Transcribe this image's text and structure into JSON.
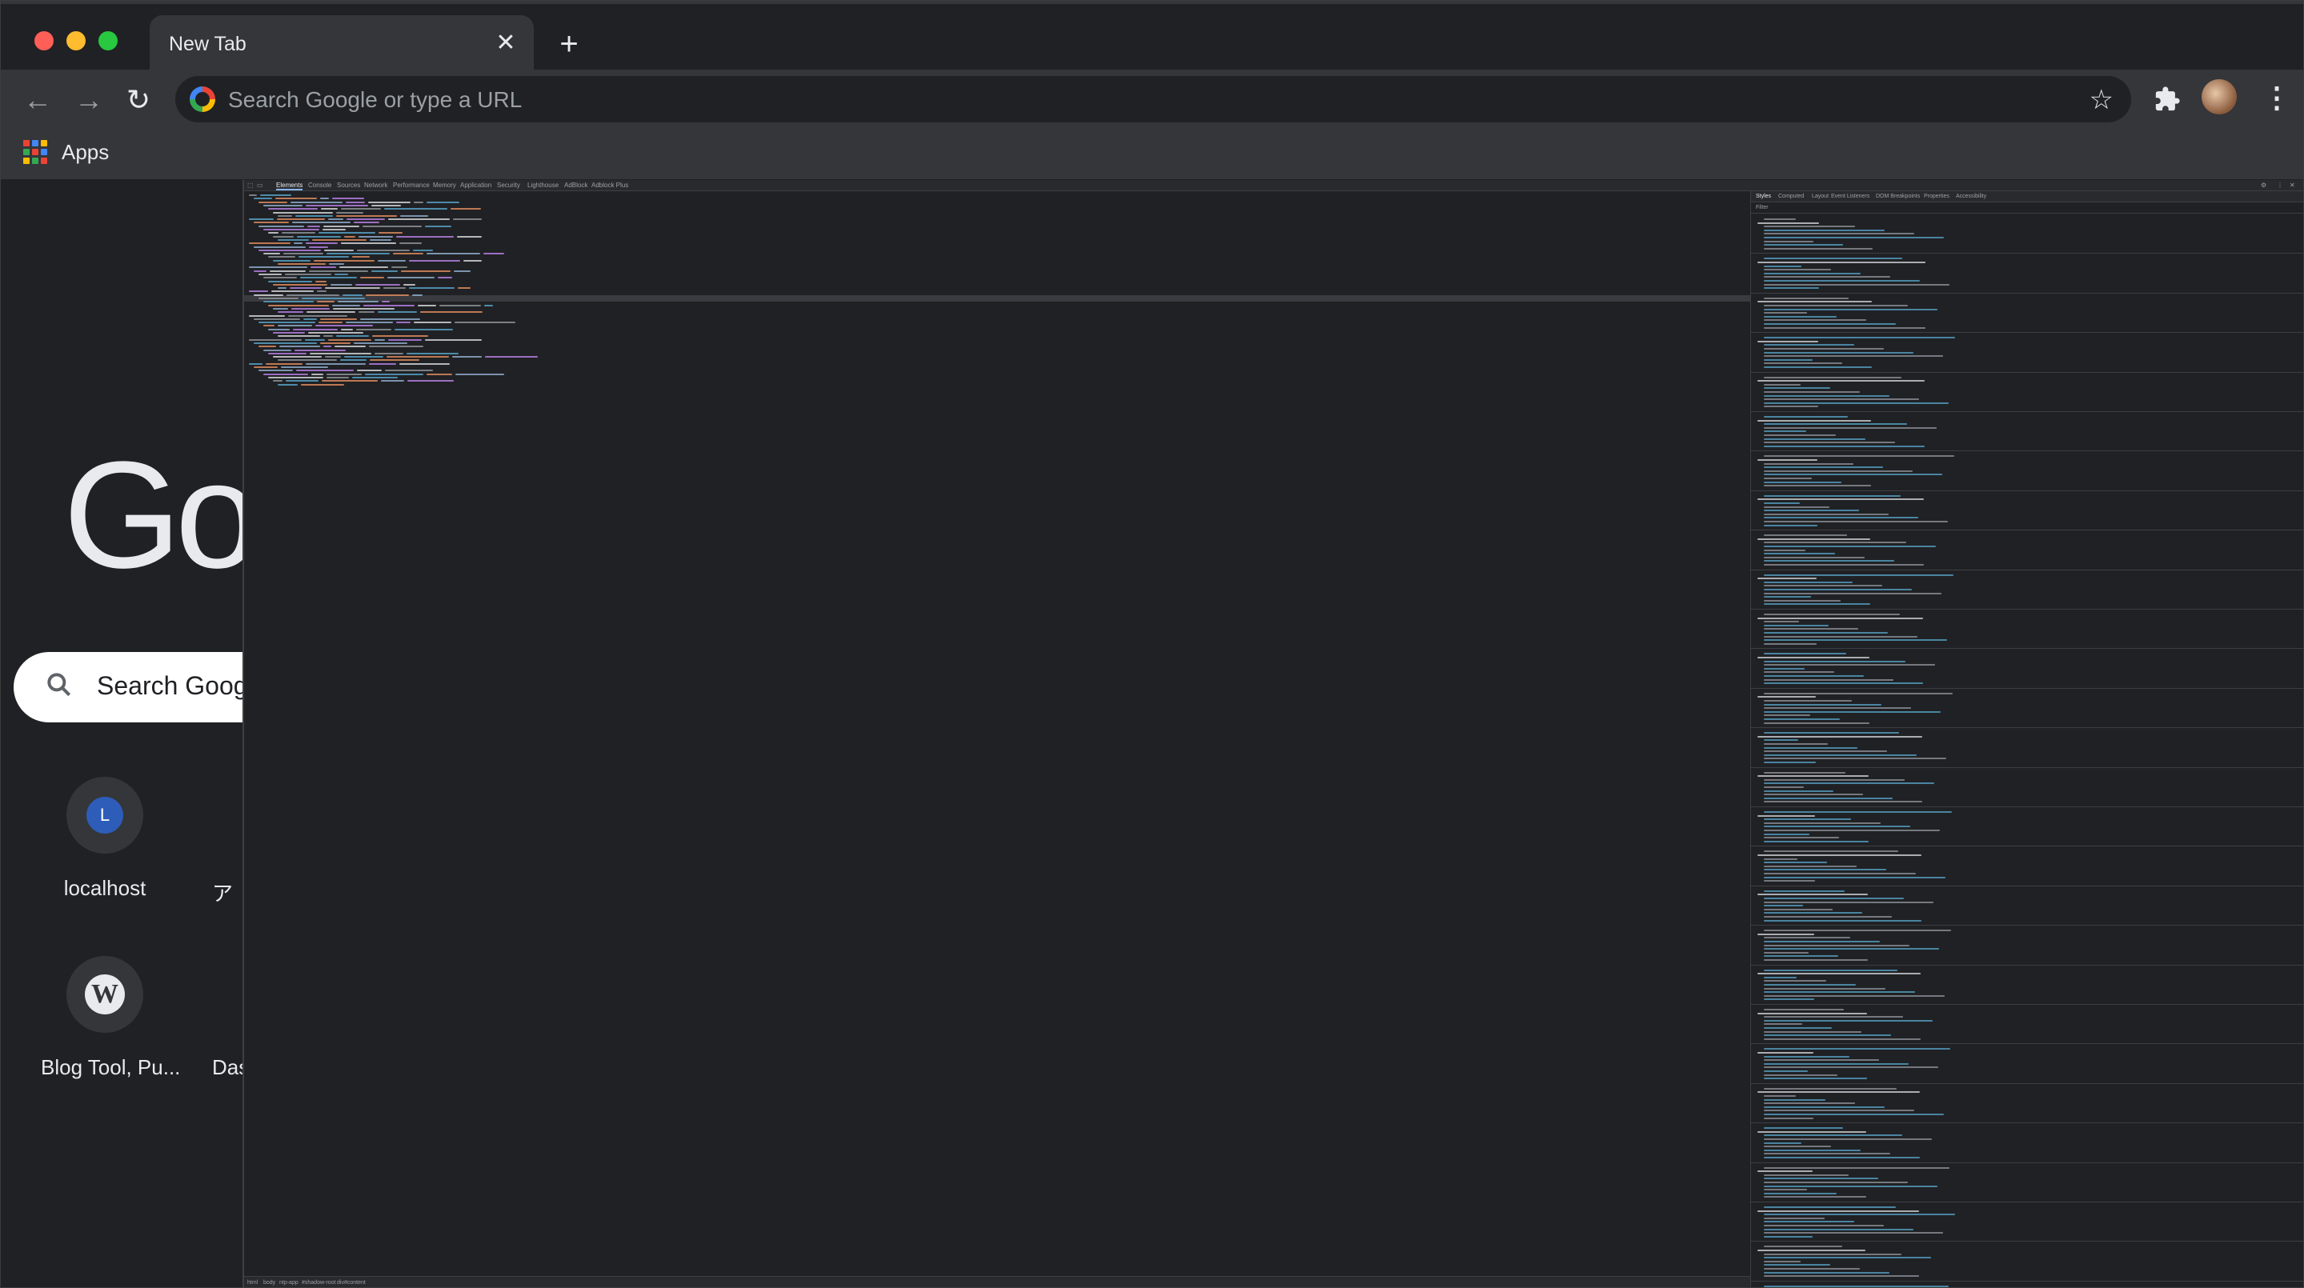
{
  "tab": {
    "title": "New Tab",
    "close": "✕"
  },
  "newtab": "+",
  "nav": {
    "back": "←",
    "forward": "→",
    "reload": "↻"
  },
  "omnibox": {
    "placeholder": "Search Google or type a URL",
    "star": "☆"
  },
  "toolbar_icons": {
    "extensions": "puzzle-icon",
    "menu": "⋮"
  },
  "bookmarks": {
    "apps_label": "Apps"
  },
  "page": {
    "logo_text": "Go",
    "search_placeholder": "Search Goog",
    "search_glyph": "🔍",
    "shortcuts": [
      {
        "label": "localhost",
        "badge": "L"
      },
      {
        "label": "Blog Tool, Pu...",
        "badge": "W"
      }
    ],
    "partial_labels": [
      "ア",
      "Das"
    ]
  },
  "devtools": {
    "tabs": [
      "Elements",
      "Console",
      "Sources",
      "Network",
      "Performance",
      "Memory",
      "Application",
      "Security",
      "Lighthouse",
      "AdBlock",
      "Adblock Plus"
    ],
    "styles_tabs": [
      "Styles",
      "Computed",
      "Layout",
      "Event Listeners",
      "DOM Breakpoints",
      "Properties",
      "Accessibility"
    ],
    "filter_placeholder": "Filter",
    "breadcrumbs": [
      "html",
      "body",
      "ntp-app",
      "#shadow-root",
      "div#content"
    ]
  },
  "colors": {
    "frame": "#202124",
    "toolbar": "#35363a",
    "text": "#e8eaed",
    "muted": "#9aa0a6",
    "accent": "#8ab4f8"
  }
}
